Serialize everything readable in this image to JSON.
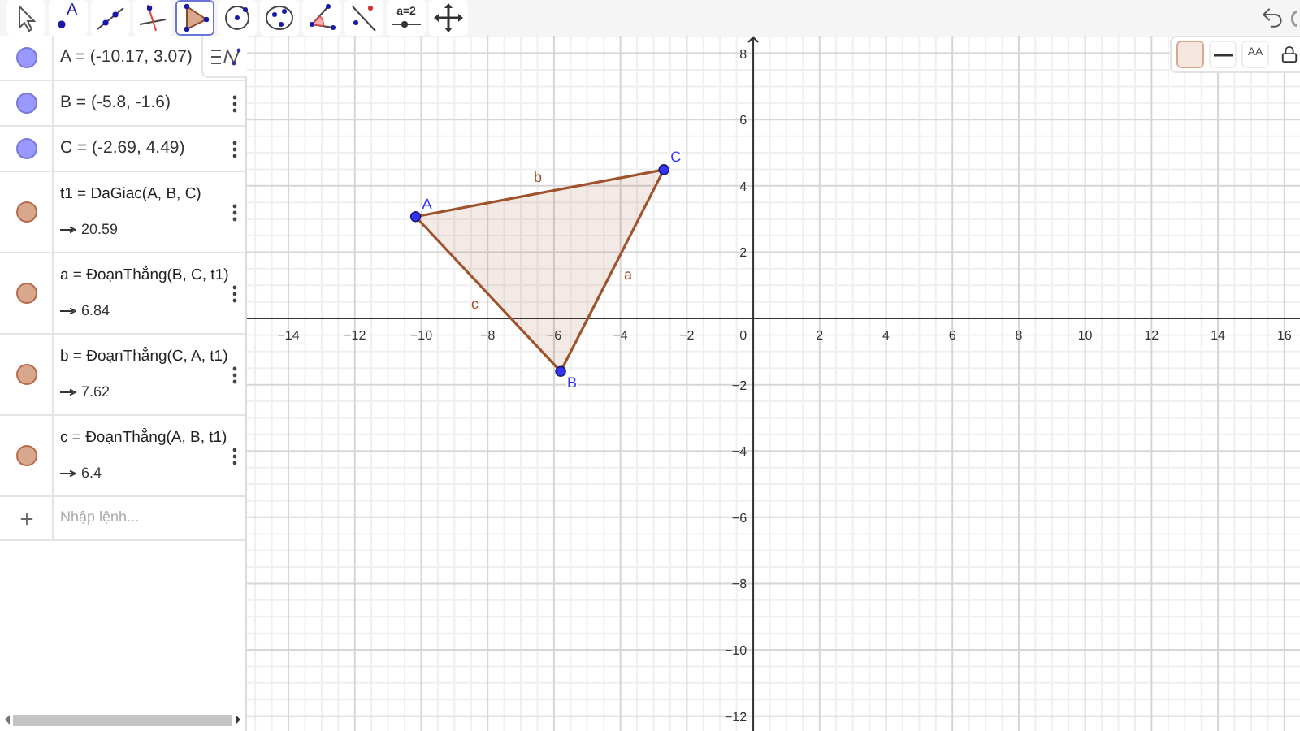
{
  "toolbar": {
    "tools": [
      {
        "kind": "move",
        "selected": false
      },
      {
        "kind": "point",
        "label": "A",
        "selected": false
      },
      {
        "kind": "line",
        "selected": false
      },
      {
        "kind": "perpendicular",
        "selected": false
      },
      {
        "kind": "polygon",
        "selected": true
      },
      {
        "kind": "circle",
        "selected": false
      },
      {
        "kind": "circle3",
        "selected": false
      },
      {
        "kind": "angle",
        "selected": false
      },
      {
        "kind": "reflect",
        "selected": false
      },
      {
        "kind": "slider",
        "label": "a=2",
        "selected": false
      },
      {
        "kind": "pan",
        "selected": false
      }
    ]
  },
  "algebra": {
    "items": [
      {
        "kind": "header",
        "color": "#9999ff",
        "text": "A = (-10.17, 3.07)"
      },
      {
        "kind": "point",
        "color": "#9999ff",
        "text": "B = (-5.8, -1.6)"
      },
      {
        "kind": "point",
        "color": "#9999ff",
        "text": "C = (-2.69, 4.49)"
      },
      {
        "kind": "shape",
        "color": "#d8a88e",
        "text": "t1 = DaGiac(A, B, C)",
        "value": "20.59"
      },
      {
        "kind": "shape",
        "color": "#d8a88e",
        "text": "a = ĐoạnThẳng(B, C, t1)",
        "value": "6.84"
      },
      {
        "kind": "shape",
        "color": "#d8a88e",
        "text": "b = ĐoạnThẳng(C, A, t1)",
        "value": "7.62"
      },
      {
        "kind": "shape",
        "color": "#d8a88e",
        "text": "c = ĐoạnThẳng(A, B, t1)",
        "value": "6.4"
      }
    ],
    "input": {
      "placeholder": "Nhập lệnh..."
    }
  },
  "graphics": {
    "chart_data": {
      "type": "scatter",
      "x": [
        -10.17,
        -5.8,
        -2.69
      ],
      "series": [
        {
          "color": "#3333ff",
          "values": [
            3.07,
            -1.6,
            4.49
          ]
        }
      ],
      "xlim": [
        -15.25,
        16.47
      ],
      "ylim": [
        -12.45,
        8.53
      ],
      "xticks": [
        -14,
        -12,
        -10,
        -8,
        -6,
        -4,
        -2,
        2,
        4,
        6,
        8,
        10,
        12,
        14,
        16
      ],
      "yticks": [
        -12,
        -10,
        -8,
        -6,
        -4,
        -2,
        2,
        4,
        6,
        8
      ],
      "grid": true
    },
    "origin_label": "0",
    "point_labels": [
      "A",
      "B",
      "C"
    ],
    "segment_labels": [
      "a",
      "b",
      "c"
    ],
    "style_bar": {
      "text_size": "AA"
    }
  }
}
